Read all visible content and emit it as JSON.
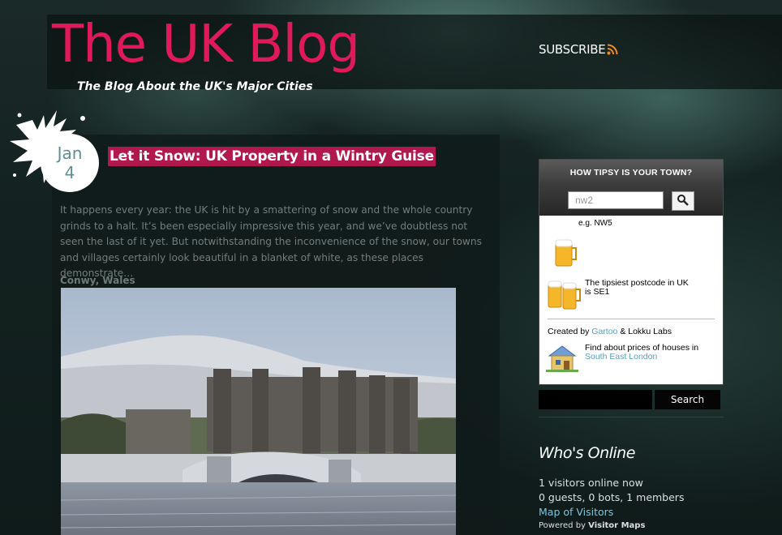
{
  "header": {
    "title": "The UK Blog",
    "tagline": "The Blog About the UK's Major Cities",
    "subscribe_label": "SUBSCRIBE"
  },
  "post": {
    "date_month": "Jan",
    "date_day": "4",
    "title": "Let it Snow:  UK Property in a Wintry Guise",
    "excerpt": "It happens every year:  the UK is hit by a smattering of snow and the whole country grinds to a halt.  It’s been especially impressive this year, and we’ve doubtless not seen the last of it yet.  But notwithstanding the inconvenience of the snow, our towns and villages certainly look beautiful in a blanket of white, as these places demonstrate…",
    "section_heading": "Conwy, Wales"
  },
  "tipsy_widget": {
    "title": "HOW TIPSY IS YOUR TOWN?",
    "input_value": "nw2",
    "example": "e.g. NW5",
    "tipsiest_text": "The tipsiest postcode in UK is SE1",
    "created_by_prefix": "Created by",
    "created_by_gartoo": "Gartoo",
    "created_by_suffix": "& Lokku Labs",
    "houses_text": "Find about prices of houses in",
    "houses_link": "South East London"
  },
  "site_search": {
    "button_label": "Search"
  },
  "whos_online": {
    "heading": "Who's Online",
    "visitors": "1 visitors online now",
    "breakdown": "0 guests, 0 bots, 1 members",
    "map_link": "Map of Visitors",
    "powered_prefix": "Powered by",
    "powered_link": "Visitor Maps"
  },
  "colors": {
    "brand_pink": "#e0195a",
    "title_bg": "#b0184e",
    "link_blue": "#7fc4de",
    "rss_orange": "#f28a1e"
  }
}
